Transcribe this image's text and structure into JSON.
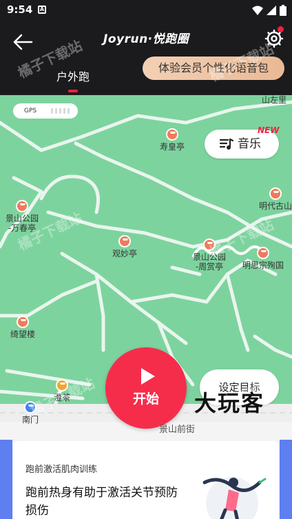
{
  "status_bar": {
    "time": "9:54",
    "app_icon": "A"
  },
  "header": {
    "logo": "Joyrun·悦跑圈",
    "tab": "户外跑",
    "voice_pack": "体验会员个性化语音包"
  },
  "map": {
    "gps_label": "GPS",
    "pois": [
      {
        "name": "寿皇亭"
      },
      {
        "name": "景山公园\n-万春亭"
      },
      {
        "name": "观妙亭"
      },
      {
        "name": "景山公园\n-周赏亭"
      },
      {
        "name": "明思宗殉国"
      },
      {
        "name": "明代古山"
      },
      {
        "name": "绮望楼"
      },
      {
        "name": "澄茶"
      },
      {
        "name": "南门"
      },
      {
        "name": "山左里"
      }
    ],
    "street": "景山前街"
  },
  "music": {
    "label": "音乐",
    "badge": "NEW"
  },
  "start": {
    "label": "开始"
  },
  "goal": {
    "label": "设定目标"
  },
  "card": {
    "subtitle": "跑前激活肌肉训练",
    "title": "跑前热身有助于激活关节预防损伤"
  },
  "watermarks": {
    "text": "橘子下载站"
  },
  "brand": "大玩客",
  "colors": {
    "accent": "#f52d4b",
    "map_green": "#7dd39e",
    "header_bg": "#1b1b1d",
    "voice_pack_gradient_start": "#f3d0b5"
  }
}
